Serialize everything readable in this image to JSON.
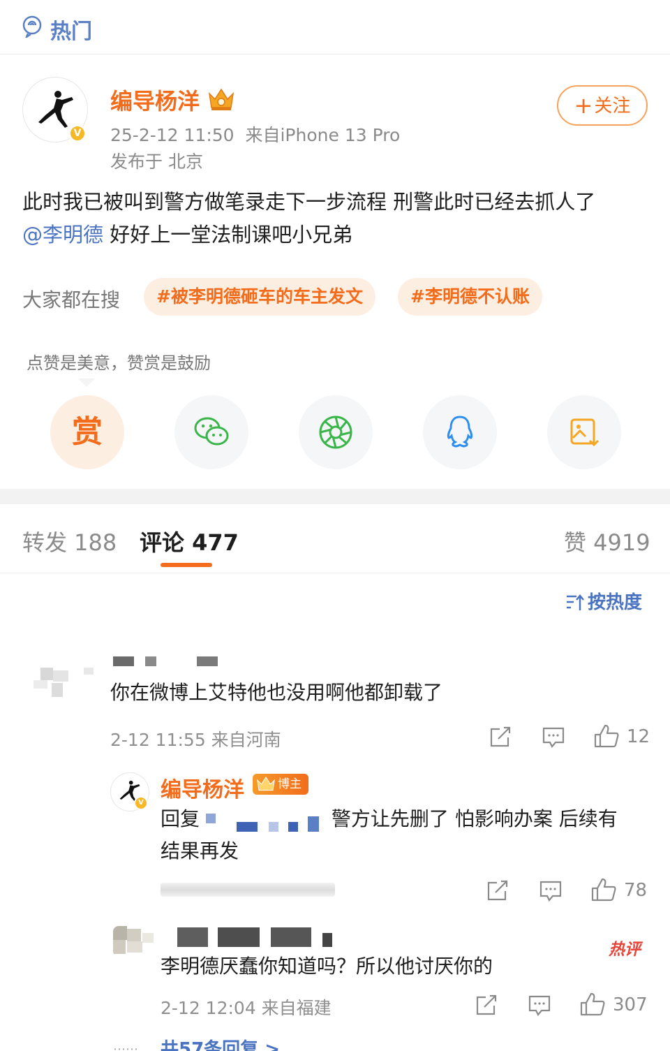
{
  "topbar": {
    "title": "热门"
  },
  "post": {
    "author": "编导杨洋",
    "timestamp": "25-2-12 11:50",
    "source": "来自iPhone 13 Pro",
    "location": "发布于 北京",
    "follow_label": "关注",
    "follow_plus": "+",
    "text_line1": "此时我已被叫到警方做笔录走下一步流程 刑警此时已经去抓人了",
    "mention": "@李明德",
    "text_line2": " 好好上一堂法制课吧小兄弟",
    "verified_mark": "V"
  },
  "search": {
    "label": "大家都在搜",
    "tags": [
      "#被李明德砸车的车主发文",
      "#李明德不认账"
    ]
  },
  "reward": {
    "tip": "点赞是美意，赞赏是鼓励",
    "reward_char": "赏",
    "share_icons": [
      "reward-icon",
      "wechat-icon",
      "moments-icon",
      "qq-icon",
      "save-image-icon"
    ]
  },
  "tabs": {
    "repost": "转发 188",
    "comment": "评论 477",
    "like": "赞 4919"
  },
  "sort": {
    "label": "按热度"
  },
  "comments": [
    {
      "text": "你在微博上艾特他也没用啊他都卸载了",
      "meta": "2-12 11:55  来自河南",
      "likes": "12"
    },
    {
      "author": "编导杨洋",
      "badge": "博主",
      "text_prefix": "回复",
      "text_suffix": "警方让先删了 怕影响办案 后续有",
      "text_line2": "结果再发",
      "likes": "78"
    },
    {
      "text": "李明德厌蠢你知道吗？所以他讨厌你的",
      "meta": "2-12 12:04  来自福建",
      "likes": "307",
      "hot_label": "热评"
    }
  ],
  "more_replies": "共57条回复 >",
  "colors": {
    "accent": "#f26c1b",
    "link": "#4a73c2",
    "muted": "#8a8a8a"
  }
}
